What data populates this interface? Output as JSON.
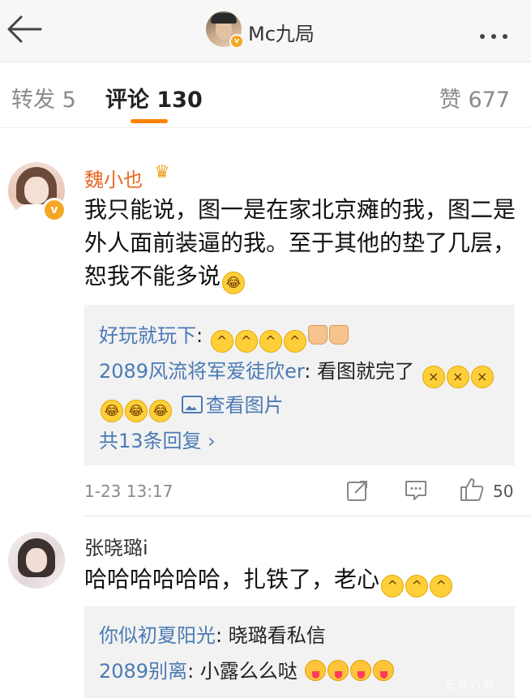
{
  "header": {
    "back_icon": "arrow-left-icon",
    "title": "Mc九局",
    "more_icon": "ellipsis-icon"
  },
  "tabs": {
    "repost": "转发 5",
    "comments": "评论 130",
    "like": "赞 677",
    "active": "comments",
    "accent_color": "#ff8200"
  },
  "comments": [
    {
      "user": "魏小也",
      "user_color": "#e86722",
      "verified": true,
      "text": "我只能说，图一是在家北京瘫的我，图二是外人面前装逼的我。至于其他的垫了几层，恕我不能多说",
      "replies": [
        {
          "user": "好玩就玩下",
          "text": ""
        },
        {
          "user": "2089风流将军爱徒欣er",
          "text": "看图就完了"
        },
        {
          "link": "查看图片"
        }
      ],
      "more_replies": "共13条回复",
      "time": "1-23 13:17",
      "likes": "50"
    },
    {
      "user": "张晓璐i",
      "text": "哈哈哈哈哈哈，扎铁了，老心",
      "replies": [
        {
          "user": "你似初夏阳光",
          "text": "晓璐看私信"
        },
        {
          "user": "2089别离",
          "text": "小露么么哒"
        }
      ]
    }
  ],
  "watermark": "左岸八卦"
}
